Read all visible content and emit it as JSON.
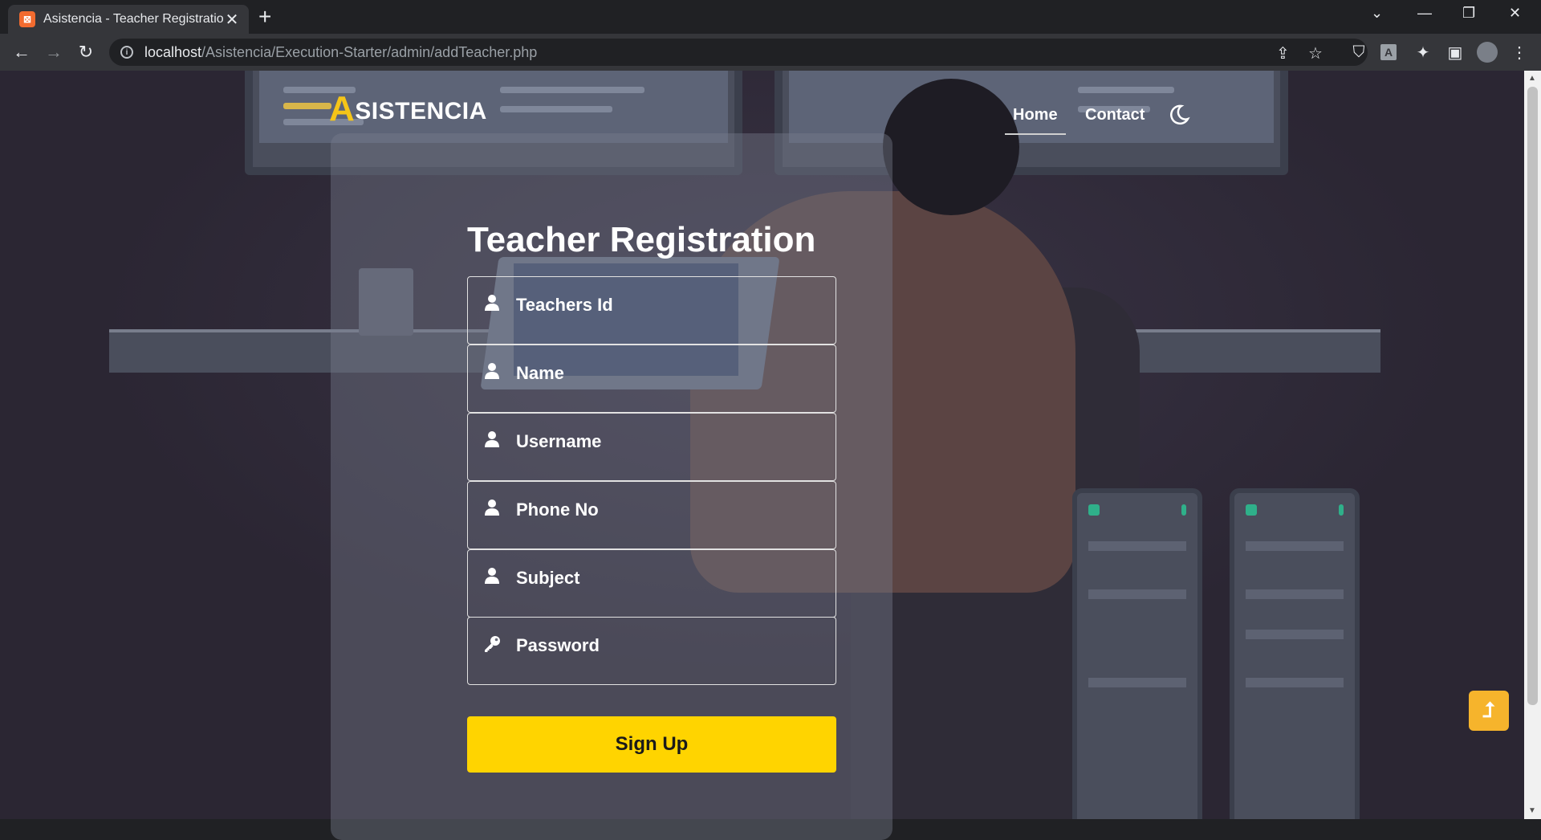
{
  "browser": {
    "tab_title": "Asistencia - Teacher Registration",
    "tab_favicon": "xampp-icon",
    "url_host": "localhost",
    "url_path": "/Asistencia/Execution-Starter/admin/addTeacher.php"
  },
  "site": {
    "logo_first": "A",
    "logo_rest": "SISTENCIA",
    "nav": {
      "home": "Home",
      "contact": "Contact"
    },
    "theme_toggle_icon": "moon-icon"
  },
  "form": {
    "title": "Teacher Registration",
    "fields": [
      {
        "placeholder": "Teachers Id",
        "icon": "user-icon"
      },
      {
        "placeholder": "Name",
        "icon": "user-icon"
      },
      {
        "placeholder": "Username",
        "icon": "user-icon"
      },
      {
        "placeholder": "Phone No",
        "icon": "user-icon"
      },
      {
        "placeholder": "Subject",
        "icon": "user-icon"
      },
      {
        "placeholder": "Password",
        "icon": "key-icon"
      }
    ],
    "submit_label": "Sign Up"
  },
  "colors": {
    "accent": "#ffd400",
    "logo_accent": "#f5c518",
    "scroll_top_button": "#f6b42c"
  }
}
